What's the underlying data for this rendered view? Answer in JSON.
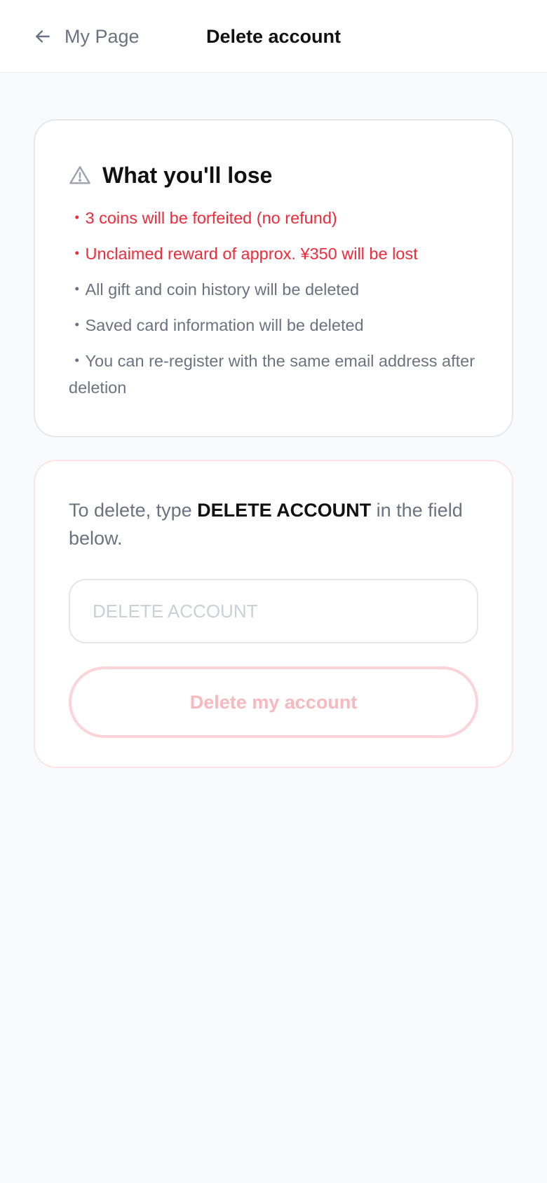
{
  "header": {
    "back_label": "My Page",
    "title": "Delete account",
    "back_icon": "arrow-left-icon"
  },
  "lose_card": {
    "icon": "warning-triangle-icon",
    "title": "What you'll lose",
    "items": [
      {
        "text": "・3 coins will be forfeited (no refund)",
        "emphasis": true
      },
      {
        "text": "・Unclaimed reward of approx. ¥350 will be lost",
        "emphasis": true
      },
      {
        "text": "・All gift and coin history will be deleted",
        "emphasis": false
      },
      {
        "text": "・Saved card information will be deleted",
        "emphasis": false
      },
      {
        "text": "・You can re-register with the same email address after deletion",
        "emphasis": false
      }
    ]
  },
  "delete_card": {
    "instruction_before": "To delete, type ",
    "instruction_keyword": "DELETE ACCOUNT",
    "instruction_after": " in the field below.",
    "input_value": "",
    "input_placeholder": "DELETE ACCOUNT",
    "button_label": "Delete my account"
  },
  "colors": {
    "warning_text": "#ef2b3a",
    "muted_text": "#6b7280",
    "disabled_button_text": "#f8b8be",
    "disabled_button_border": "#fcd3d6"
  }
}
